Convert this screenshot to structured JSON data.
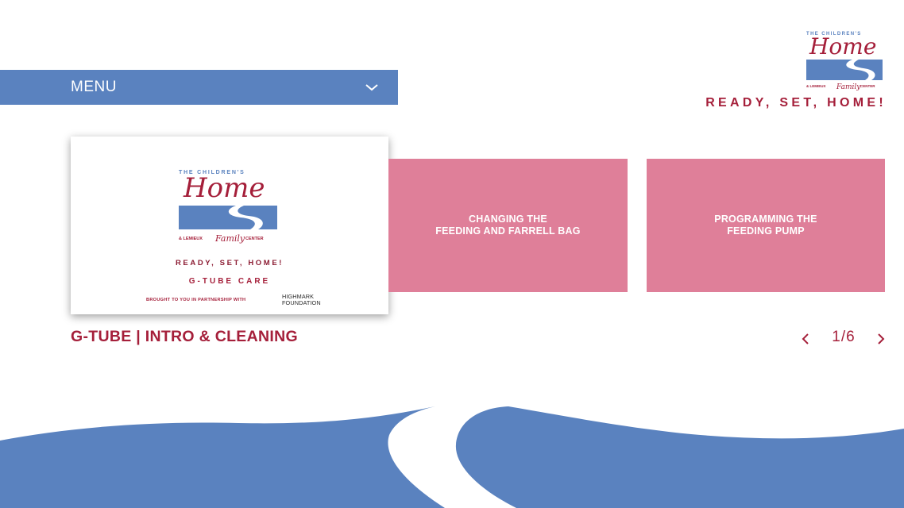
{
  "menu": {
    "label": "MENU",
    "chevron_icon": "chevron-down-icon"
  },
  "brand": {
    "logo_line1": "THE CHILDREN'S",
    "logo_main": "Home",
    "logo_line3a": "& LEMIEUX",
    "logo_line3b": "Family",
    "logo_line3c": "CENTER",
    "tagline": "READY, SET, HOME!"
  },
  "carousel": {
    "cards": [
      {
        "type": "thumbnail",
        "logo_line1": "THE CHILDREN'S",
        "logo_main": "Home",
        "logo_line3a": "& LEMIEUX",
        "logo_line3b": "Family",
        "logo_line3c": "CENTER",
        "tagline": "READY, SET, HOME!",
        "subtitle": "G-TUBE CARE",
        "partner_text": "BROUGHT TO YOU IN PARTNERSHIP WITH",
        "partner_name_1": "HIGHMARK",
        "partner_name_2": "FOUNDATION"
      },
      {
        "type": "tile",
        "line1": "CHANGING THE",
        "line2": "FEEDING AND FARRELL BAG"
      },
      {
        "type": "tile",
        "line1": "PROGRAMMING THE",
        "line2": "FEEDING PUMP"
      }
    ],
    "selected_title": "G-TUBE | INTRO & CLEANING",
    "page_indicator": "1/6",
    "prev_icon": "chevron-left-icon",
    "next_icon": "chevron-right-icon"
  },
  "colors": {
    "brand_blue": "#5a82bf",
    "brand_red": "#a51f3a",
    "tile_pink": "#df7f99",
    "background": "#ffffff"
  }
}
